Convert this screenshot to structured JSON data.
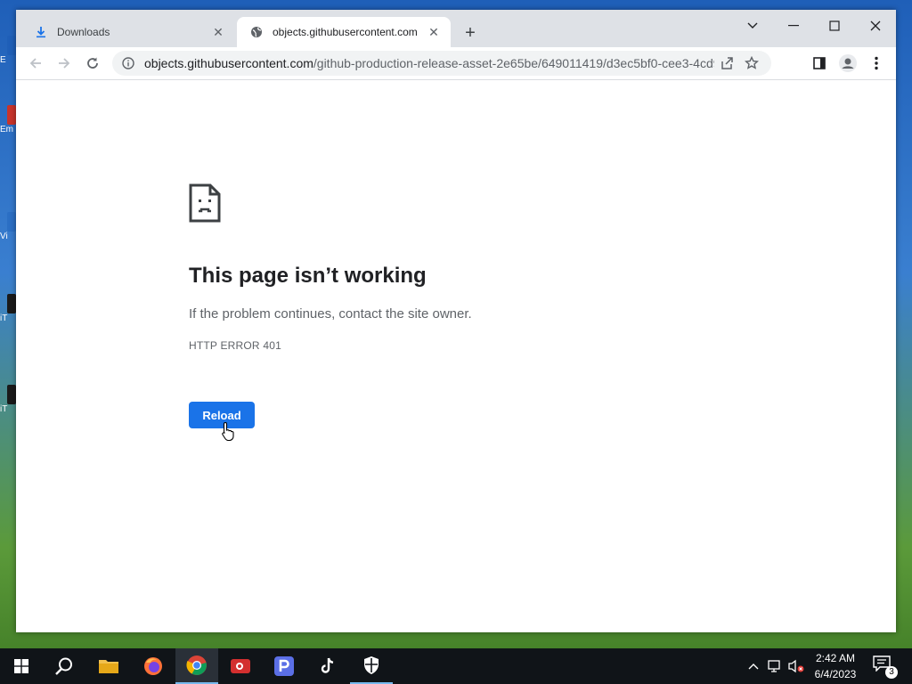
{
  "desktop": {
    "icon_label_fragments": [
      "E",
      "Em",
      "",
      "Vi",
      "iT",
      "iT"
    ]
  },
  "browser": {
    "tabs": [
      {
        "title": "Downloads",
        "icon": "download-icon",
        "active": false
      },
      {
        "title": "objects.githubusercontent.com",
        "icon": "globe-icon",
        "active": true
      }
    ],
    "address_bar": {
      "host": "objects.githubusercontent.com",
      "path": "/github-production-release-asset-2e65be/649011419/d3ec5bf0-cee3-4cd9-..."
    }
  },
  "page": {
    "title": "This page isn’t working",
    "description": "If the problem continues, contact the site owner.",
    "error_code": "HTTP ERROR 401",
    "reload_label": "Reload",
    "accent_color": "#1a73e8"
  },
  "taskbar": {
    "apps": [
      "start-icon",
      "search-icon",
      "file-explorer-icon",
      "firefox-icon",
      "chrome-icon",
      "screen-recorder-icon",
      "p-app-icon",
      "tiktok-icon",
      "security-shield-icon"
    ],
    "clock": {
      "time": "2:42 AM",
      "date": "6/4/2023"
    },
    "notification_count": "3"
  }
}
